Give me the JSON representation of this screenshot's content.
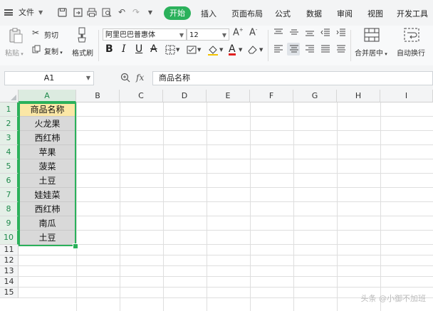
{
  "menubar": {
    "file_label": "文件",
    "tabs": [
      "开始",
      "插入",
      "页面布局",
      "公式",
      "数据",
      "审阅",
      "视图",
      "开发工具"
    ],
    "active_tab": "开始"
  },
  "ribbon": {
    "paste_label": "粘贴",
    "cut_label": "剪切",
    "copy_label": "复制",
    "format_painter_label": "格式刷",
    "font_name": "阿里巴巴普惠体",
    "font_size": "12",
    "merge_label": "合并居中",
    "wrap_label": "自动换行"
  },
  "formula_bar": {
    "cell_ref": "A1",
    "fx": "fx",
    "content": "商品名称"
  },
  "sheet": {
    "columns": [
      "A",
      "B",
      "C",
      "D",
      "E",
      "F",
      "G",
      "H",
      "I"
    ],
    "row_numbers": [
      "1",
      "2",
      "3",
      "4",
      "5",
      "6",
      "7",
      "8",
      "9",
      "10",
      "11",
      "12",
      "13",
      "14",
      "15"
    ],
    "column_a": [
      "商品名称",
      "火龙果",
      "西红柿",
      "苹果",
      "菠菜",
      "土豆",
      "娃娃菜",
      "西红柿",
      "南瓜",
      "土豆"
    ]
  },
  "watermark": "头条 @小御不加班",
  "colors": {
    "accent": "#2bb15b",
    "header_fill": "#fbe7a6",
    "cell_fill": "#d9d9d9"
  }
}
